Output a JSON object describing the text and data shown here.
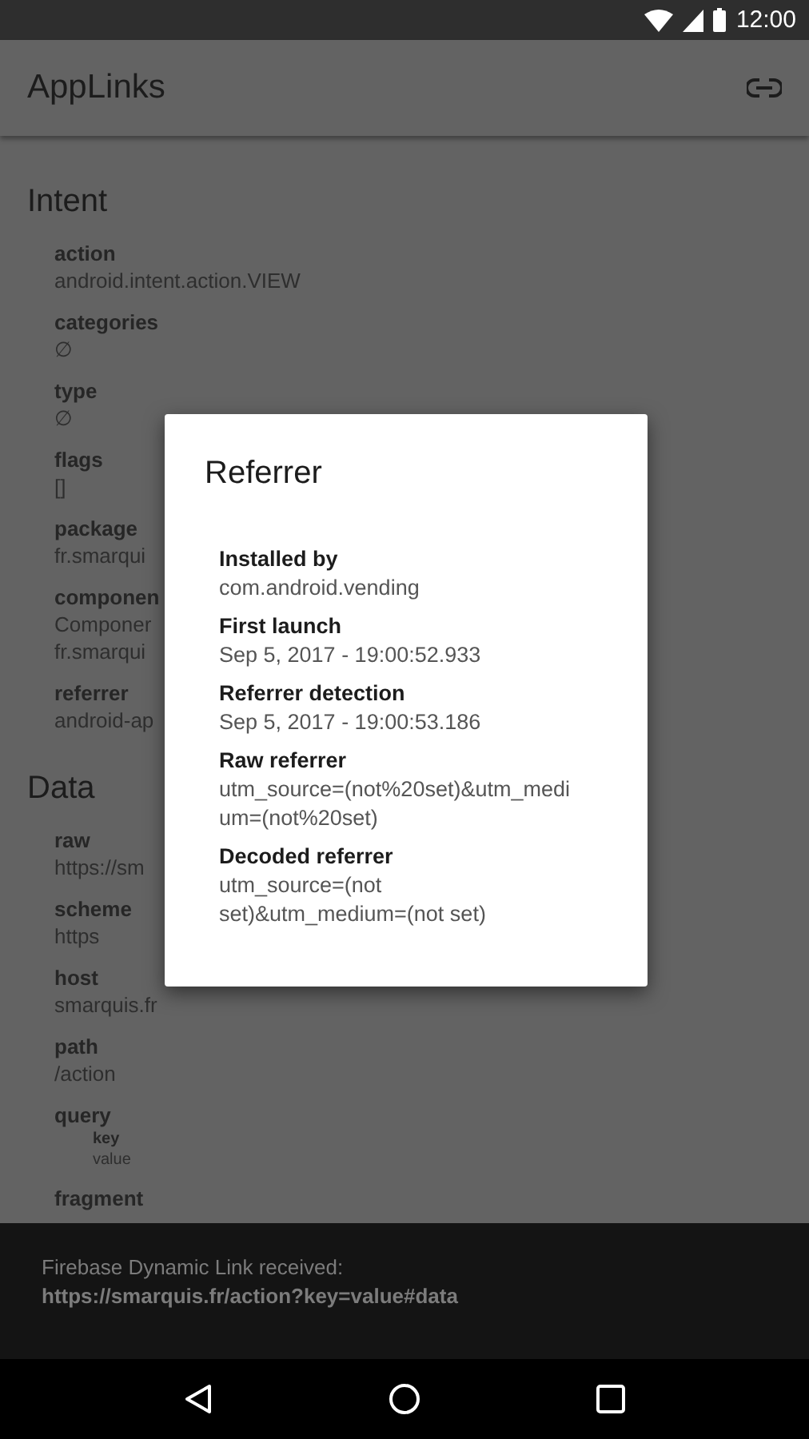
{
  "status_bar": {
    "time": "12:00"
  },
  "toolbar": {
    "title": "AppLinks"
  },
  "sections": [
    {
      "title": "Intent",
      "items": [
        {
          "label": "action",
          "lines": [
            "android.intent.action.VIEW"
          ]
        },
        {
          "label": "categories",
          "lines": [
            "∅"
          ]
        },
        {
          "label": "type",
          "lines": [
            "∅"
          ]
        },
        {
          "label": "flags",
          "lines": [
            "[]"
          ]
        },
        {
          "label": "package",
          "lines": [
            "fr.smarqui"
          ]
        },
        {
          "label": "componen",
          "lines": [
            "Componer",
            "fr.smarqui"
          ]
        },
        {
          "label": "referrer",
          "lines": [
            "android-ap"
          ]
        }
      ]
    },
    {
      "title": "Data",
      "items": [
        {
          "label": "raw",
          "lines": [
            "https://sm"
          ]
        },
        {
          "label": "scheme",
          "lines": [
            "https"
          ]
        },
        {
          "label": "host",
          "lines": [
            "smarquis.fr"
          ]
        },
        {
          "label": "path",
          "lines": [
            "/action"
          ]
        },
        {
          "label": "query",
          "children": [
            {
              "label": "key",
              "lines": [
                "value"
              ]
            }
          ]
        },
        {
          "label": "fragment"
        }
      ]
    }
  ],
  "dialog": {
    "title": "Referrer",
    "fields": [
      {
        "label": "Installed by",
        "value": "com.android.vending"
      },
      {
        "label": "First launch",
        "value": "Sep 5, 2017 - 19:00:52.933"
      },
      {
        "label": "Referrer detection",
        "value": "Sep 5, 2017 - 19:00:53.186"
      },
      {
        "label": "Raw referrer",
        "value": "utm_source=(not%20set)&utm_medium=(not%20set)",
        "kind": "raw"
      },
      {
        "label": "Decoded referrer",
        "value": "utm_source=(not set)&utm_medium=(not set)",
        "kind": "text"
      }
    ]
  },
  "snackbar": {
    "message": "Firebase Dynamic Link received:",
    "link": "https://smarquis.fr/action?key=value#data"
  }
}
